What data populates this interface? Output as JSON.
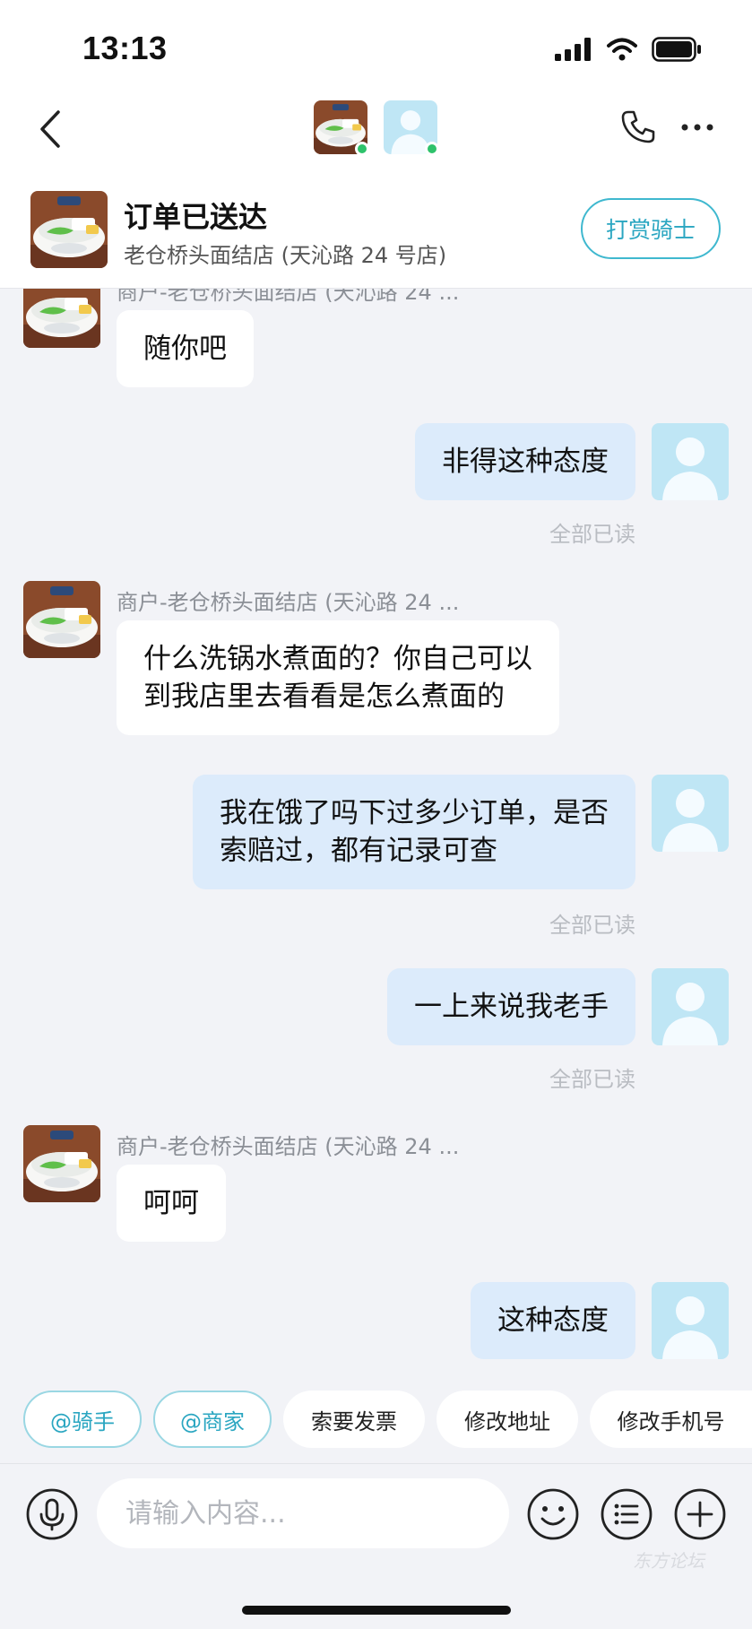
{
  "status_bar": {
    "time": "13:13"
  },
  "order": {
    "status": "订单已送达",
    "shop_name": "老仓桥头面结店 (天沁路 24 号店)",
    "tip_button": "打赏骑士"
  },
  "messages": [
    {
      "dir": "in",
      "sender": "商户-老仓桥头面结店 (天沁路 24 ...",
      "lines": [
        "随你吧"
      ]
    },
    {
      "dir": "out",
      "lines": [
        "非得这种态度"
      ],
      "read": "全部已读"
    },
    {
      "dir": "in",
      "sender": "商户-老仓桥头面结店 (天沁路 24 ...",
      "lines": [
        "什么洗锅水煮面的？你自己可以",
        "到我店里去看看是怎么煮面的"
      ]
    },
    {
      "dir": "out",
      "lines": [
        "我在饿了吗下过多少订单，是否",
        "索赔过，都有记录可查"
      ],
      "read": "全部已读"
    },
    {
      "dir": "out",
      "lines": [
        "一上来说我老手"
      ],
      "read": "全部已读"
    },
    {
      "dir": "in",
      "sender": "商户-老仓桥头面结店 (天沁路 24 ...",
      "lines": [
        "呵呵"
      ]
    },
    {
      "dir": "out",
      "lines": [
        "这种态度"
      ]
    }
  ],
  "quick_actions": [
    "@骑手",
    "@商家",
    "索要发票",
    "修改地址",
    "修改手机号"
  ],
  "input": {
    "placeholder": "请输入内容..."
  },
  "watermark": "东方论坛",
  "icons": {
    "back": "chevron-left-icon",
    "phone": "phone-icon",
    "more": "more-icon",
    "mic": "microphone-icon",
    "emoji": "emoji-icon",
    "menu": "list-icon",
    "plus": "plus-icon"
  },
  "colors": {
    "accent": "#2aa6c1",
    "outgoing_bubble": "#dcebfb",
    "incoming_bubble": "#ffffff",
    "background": "#f2f3f7",
    "online": "#2ec26b"
  }
}
